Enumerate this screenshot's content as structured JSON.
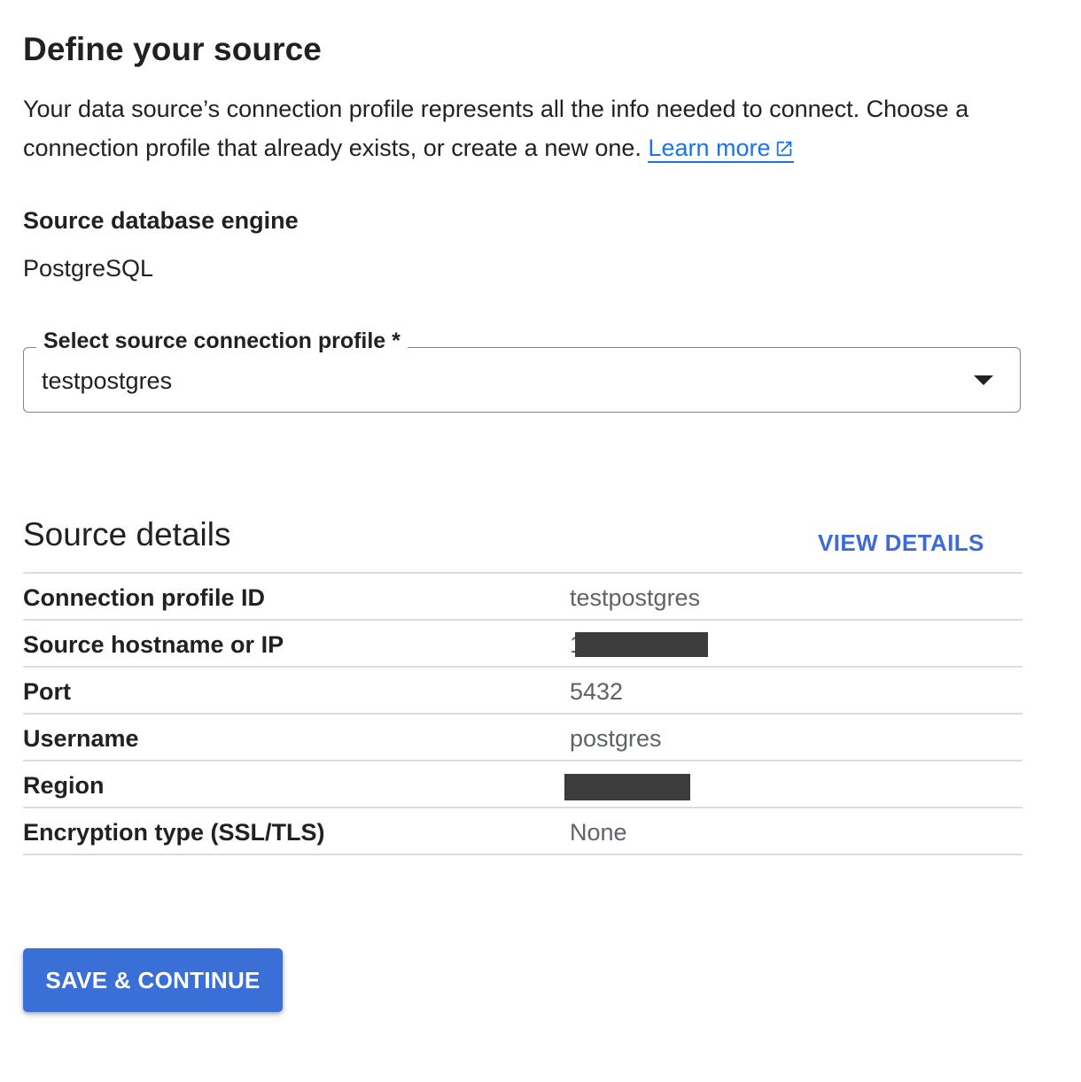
{
  "header": {
    "title": "Define your source",
    "description": "Your data source’s connection profile represents all the info needed to connect. Choose a connection profile that already exists, or create a new one.",
    "learn_more": "Learn more"
  },
  "engine": {
    "label": "Source database engine",
    "value": "PostgreSQL"
  },
  "profile_select": {
    "label": "Select source connection profile *",
    "value": "testpostgres",
    "icon": "dropdown-arrow-icon"
  },
  "source_details": {
    "title": "Source details",
    "view_details": "VIEW DETAILS",
    "rows": [
      {
        "key": "Connection profile ID",
        "value": "testpostgres"
      },
      {
        "key": "Source hostname or IP",
        "value": "1"
      },
      {
        "key": "Port",
        "value": "5432"
      },
      {
        "key": "Username",
        "value": "postgres"
      },
      {
        "key": "Region",
        "value": ""
      },
      {
        "key": "Encryption type (SSL/TLS)",
        "value": "None"
      }
    ]
  },
  "actions": {
    "save_continue": "SAVE & CONTINUE"
  },
  "colors": {
    "link": "#1a73e8",
    "accent_text": "#3c6bd6",
    "primary_button": "#3a6fd8",
    "divider": "#dadce0"
  }
}
